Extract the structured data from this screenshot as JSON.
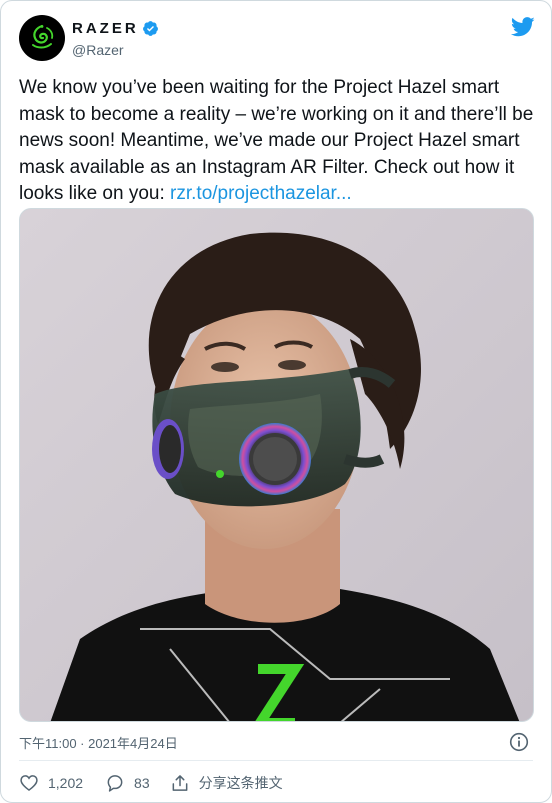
{
  "account": {
    "display_name": "RAZER",
    "handle": "@Razer",
    "verified": true,
    "avatar_icon": "razer-snake-logo"
  },
  "tweet": {
    "text": "We know you’ve been waiting for the Project Hazel smart mask to become a reality – we’re working on it and there’ll be news soon! Meantime, we’ve made our Project Hazel smart mask available as an Instagram AR Filter. Check out how it looks like on you: ",
    "link_text": "rzr.to/projecthazelar...",
    "link_color": "#1b95e0"
  },
  "media": {
    "icon": "photo-man-wearing-smart-mask"
  },
  "meta": {
    "timestamp": "下午11:00 · 2021年4月24日"
  },
  "actions": {
    "like_count": "1,202",
    "reply_count": "83",
    "share_label": "分享这条推文"
  },
  "colors": {
    "brand_blue": "#1d9bf0",
    "razer_green": "#44d62c",
    "secondary_text": "#536471"
  }
}
